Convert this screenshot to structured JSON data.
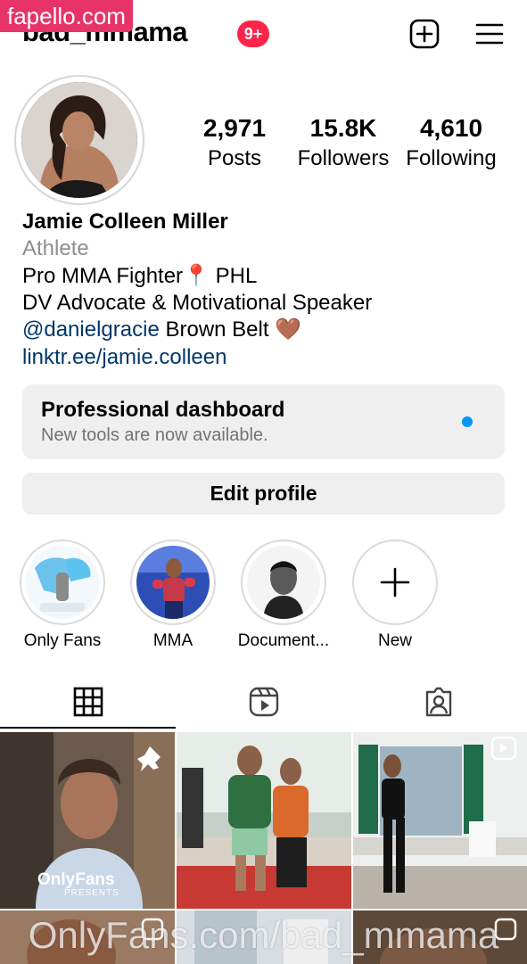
{
  "watermark_top": "fapello.com",
  "header": {
    "username": "bad_mmama",
    "notification_badge": "9+",
    "icons": [
      "new-post-icon",
      "menu-icon"
    ]
  },
  "stats": [
    {
      "value": "2,971",
      "label": "Posts"
    },
    {
      "value": "15.8K",
      "label": "Followers"
    },
    {
      "value": "4,610",
      "label": "Following"
    }
  ],
  "bio": {
    "name": "Jamie Colleen Miller",
    "category": "Athlete",
    "line1_text": "Pro MMA Fighter",
    "line1_emoji": "📍",
    "line1_rest": "PHL",
    "line2": "DV Advocate & Motivational Speaker",
    "line3_mention": "@danielgracie",
    "line3_rest": "Brown Belt",
    "line3_emoji": "🤎",
    "link": "linktr.ee/jamie.colleen"
  },
  "dashboard": {
    "title": "Professional dashboard",
    "subtitle": "New tools are now available."
  },
  "edit_profile_label": "Edit profile",
  "highlights": [
    {
      "label": "Only Fans",
      "icon": "onlyfans-highlight"
    },
    {
      "label": "MMA",
      "icon": "mma-highlight"
    },
    {
      "label": "Document...",
      "icon": "document-highlight"
    },
    {
      "label": "New",
      "icon": "plus-icon"
    }
  ],
  "tabs": [
    "grid-icon",
    "reels-icon",
    "tagged-icon"
  ],
  "grid": {
    "post1_overlay_logo": "OnlyFans",
    "post1_overlay_sub": "PRESENTS"
  },
  "watermark_bottom": "OnlyFans.com/bad_mmama",
  "colors": {
    "badge": "#ff2449",
    "link": "#00376b",
    "blue_dot": "#0095f6",
    "button_bg": "#efefef",
    "watermark_pink": "#e8336a"
  }
}
